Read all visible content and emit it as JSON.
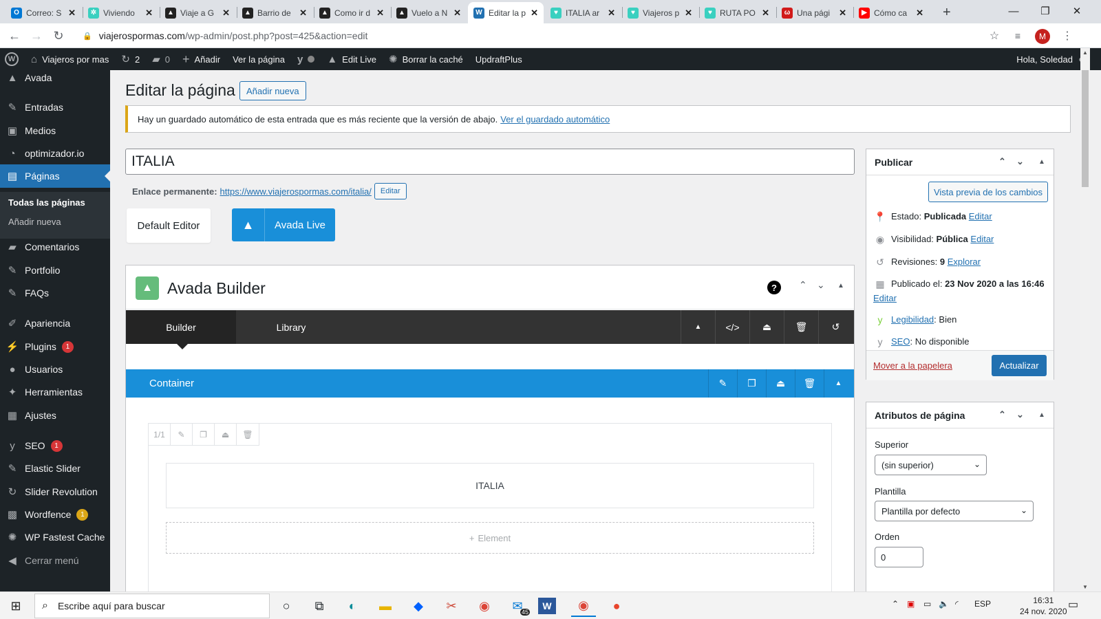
{
  "browser": {
    "tabs": [
      {
        "title": "Correo: S",
        "icon_color": "#0078d4",
        "icon_letter": "O"
      },
      {
        "title": "Viviendo",
        "icon_color": "#3ad0c0",
        "icon_letter": "✲"
      },
      {
        "title": "Viaje a G",
        "icon_color": "#222222",
        "icon_letter": "▲"
      },
      {
        "title": "Barrio de",
        "icon_color": "#222222",
        "icon_letter": "▲"
      },
      {
        "title": "Como ir d",
        "icon_color": "#222222",
        "icon_letter": "▲"
      },
      {
        "title": "Vuelo a N",
        "icon_color": "#222222",
        "icon_letter": "▲"
      },
      {
        "title": "Editar la p",
        "icon_color": "#2271b1",
        "icon_letter": "W"
      },
      {
        "title": "ITALIA ar",
        "icon_color": "#3ad0c0",
        "icon_letter": "♥"
      },
      {
        "title": "Viajeros p",
        "icon_color": "#3ad0c0",
        "icon_letter": "♥"
      },
      {
        "title": "RUTA PO",
        "icon_color": "#3ad0c0",
        "icon_letter": "♥"
      },
      {
        "title": "Una pági",
        "icon_color": "#d11a1a",
        "icon_letter": "ω"
      },
      {
        "title": "Cómo ca",
        "icon_color": "#ff0000",
        "icon_letter": "▶"
      }
    ],
    "active_tab": 6,
    "new_tab": "+",
    "url_host": "viajerospormas.com",
    "url_path": "/wp-admin/post.php?post=425&action=edit",
    "profile_initial": "M"
  },
  "adminbar": {
    "site": "Viajeros por mas",
    "updates": "2",
    "comments": "0",
    "add": "Añadir",
    "view": "Ver la página",
    "edit_live": "Edit Live",
    "cache": "Borrar la caché",
    "updraft": "UpdraftPlus",
    "greeting": "Hola, Soledad"
  },
  "sidebar": {
    "items": [
      {
        "label": "Avada",
        "icon": "avada-icon"
      },
      {
        "label": "Entradas",
        "icon": "pin-icon"
      },
      {
        "label": "Medios",
        "icon": "media-icon"
      },
      {
        "label": "optimizador.io",
        "icon": "gauge-icon"
      },
      {
        "label": "Páginas",
        "icon": "pages-icon"
      },
      {
        "label": "Comentarios",
        "icon": "comment-icon"
      },
      {
        "label": "Portfolio",
        "icon": "pin-icon"
      },
      {
        "label": "FAQs",
        "icon": "pin-icon"
      },
      {
        "label": "Apariencia",
        "icon": "brush-icon"
      },
      {
        "label": "Plugins",
        "icon": "plug-icon",
        "badge": "1"
      },
      {
        "label": "Usuarios",
        "icon": "user-icon"
      },
      {
        "label": "Herramientas",
        "icon": "wrench-icon"
      },
      {
        "label": "Ajustes",
        "icon": "settings-icon"
      },
      {
        "label": "SEO",
        "icon": "yoast-icon",
        "badge": "1"
      },
      {
        "label": "Elastic Slider",
        "icon": "pin-icon"
      },
      {
        "label": "Slider Revolution",
        "icon": "refresh-icon"
      },
      {
        "label": "Wordfence",
        "icon": "wordfence-icon",
        "badge": "1"
      },
      {
        "label": "WP Fastest Cache",
        "icon": "cheetah-icon"
      },
      {
        "label": "Cerrar menú",
        "icon": "collapse-icon"
      }
    ],
    "submenu": [
      "Todas las páginas",
      "Añadir nueva"
    ]
  },
  "page": {
    "title": "Editar la página",
    "add_new": "Añadir nueva",
    "notice_text": "Hay un guardado automático de esta entrada que es más reciente que la versión de abajo.",
    "notice_link": "Ver el guardado automático",
    "post_title": "ITALIA",
    "permalink_label": "Enlace permanente:",
    "permalink_url": "https://www.viajerospormas.com/italia/",
    "permalink_edit": "Editar",
    "default_editor": "Default Editor",
    "avada_live": "Avada Live"
  },
  "builder": {
    "title": "Avada Builder",
    "tabs": [
      "Builder",
      "Library"
    ],
    "container_label": "Container",
    "column_size": "1/1",
    "element_text": "ITALIA",
    "add_element": "Element"
  },
  "publish": {
    "title": "Publicar",
    "preview": "Vista previa de los cambios",
    "status_label": "Estado:",
    "status_value": "Publicada",
    "visibility_label": "Visibilidad:",
    "visibility_value": "Pública",
    "revisions_label": "Revisiones:",
    "revisions_value": "9",
    "revisions_link": "Explorar",
    "published_label": "Publicado el:",
    "published_value": "23 Nov 2020 a las 16:46",
    "edit": "Editar",
    "readability_link": "Legibilidad",
    "readability_value": ": Bien",
    "seo_link": "SEO",
    "seo_value": ": No disponible",
    "trash": "Mover a la papelera",
    "update": "Actualizar"
  },
  "attributes": {
    "title": "Atributos de página",
    "parent_label": "Superior",
    "parent_value": "(sin superior)",
    "template_label": "Plantilla",
    "template_value": "Plantilla por defecto",
    "order_label": "Orden",
    "order_value": "0"
  },
  "taskbar": {
    "search_placeholder": "Escribe aquí para buscar",
    "mail_badge": "45",
    "lang": "ESP",
    "time": "16:31",
    "date": "24 nov. 2020"
  },
  "colors": {
    "wp_blue": "#2271b1",
    "avada_blue": "#198fd9",
    "admin_dark": "#1d2327",
    "avada_green": "#65bc7b",
    "notice_yellow": "#dba617"
  }
}
